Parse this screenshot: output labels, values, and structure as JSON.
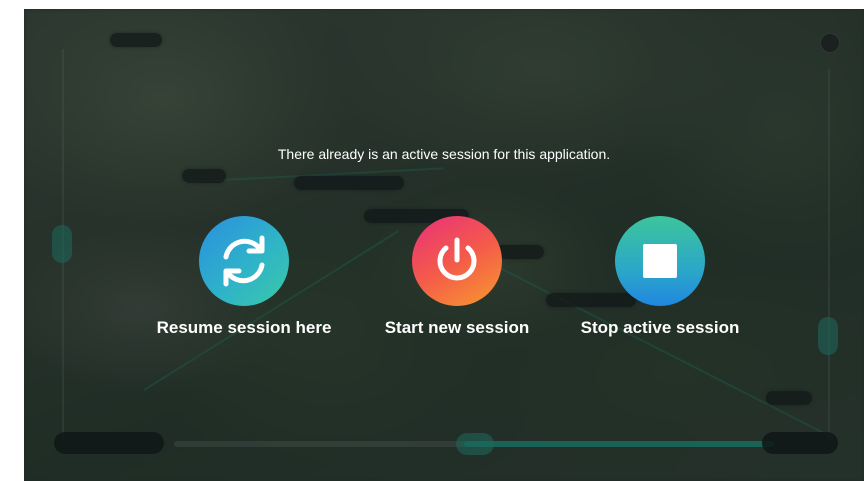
{
  "dialog": {
    "message": "There already is an active session for this application.",
    "actions": [
      {
        "label": "Resume session here",
        "icon": "refresh-icon"
      },
      {
        "label": "Start new session",
        "icon": "power-icon"
      },
      {
        "label": "Stop active session",
        "icon": "stop-icon"
      }
    ]
  },
  "colors": {
    "resume_gradient": [
      "#2a8fe0",
      "#3ac9a6"
    ],
    "start_gradient": [
      "#e8317a",
      "#f89a2e"
    ],
    "stop_gradient": [
      "#3dc59c",
      "#2187e0"
    ],
    "accent": "#1fb99a"
  }
}
